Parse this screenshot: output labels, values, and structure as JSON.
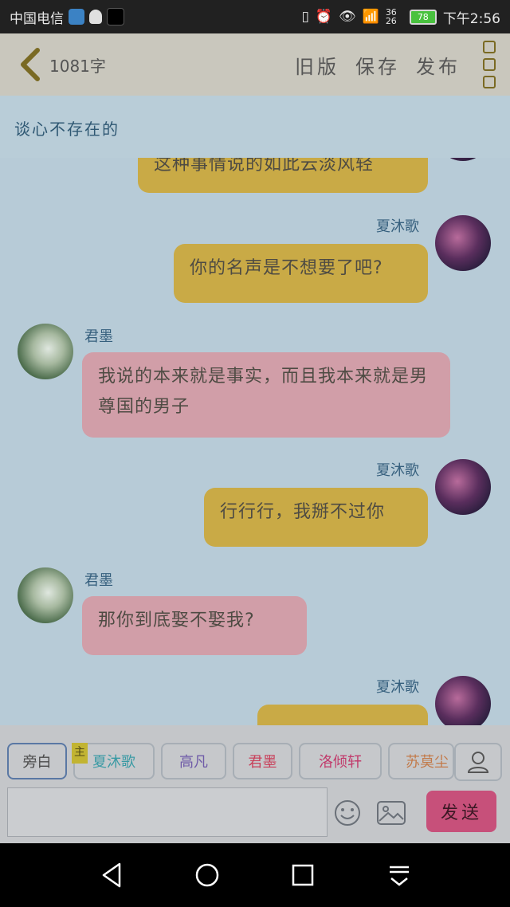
{
  "status": {
    "carrier": "中国电信",
    "network": "36 26",
    "battery": "78",
    "time": "下午2:56"
  },
  "topbar": {
    "wordcount": "1081字",
    "old_version": "旧版",
    "save": "保存",
    "publish": "发布"
  },
  "story": {
    "title": "谈心不存在的"
  },
  "messages": [
    {
      "side": "right",
      "speaker": "",
      "text": "这种事情说的如此云淡风轻",
      "color": "yellow"
    },
    {
      "side": "right",
      "speaker": "夏沐歌",
      "text": "你的名声是不想要了吧?",
      "color": "yellow"
    },
    {
      "side": "left",
      "speaker": "君墨",
      "text": "我说的本来就是事实，而且我本来就是男尊国的男子",
      "color": "pink"
    },
    {
      "side": "right",
      "speaker": "夏沐歌",
      "text": "行行行，我掰不过你",
      "color": "yellow"
    },
    {
      "side": "left",
      "speaker": "君墨",
      "text": "那你到底娶不娶我?",
      "color": "pink"
    },
    {
      "side": "right",
      "speaker": "夏沐歌",
      "text": "",
      "color": "yellow"
    }
  ],
  "roles": {
    "main_tag": "主",
    "items": [
      {
        "label": "旁白",
        "color": "#4b4b4b"
      },
      {
        "label": "夏沐歌",
        "color": "#3a9aa4"
      },
      {
        "label": "高凡",
        "color": "#6f5ba8"
      },
      {
        "label": "君墨",
        "color": "#c8405a"
      },
      {
        "label": "洛倾轩",
        "color": "#c13a6b"
      },
      {
        "label": "苏莫尘",
        "color": "#c27a4a"
      }
    ]
  },
  "composer": {
    "placeholder": "",
    "send_label": "发送"
  },
  "colors": {
    "bubble_yellow": "#c9aa46",
    "bubble_pink": "#d19ea8",
    "send_button": "#c7507a",
    "speaker_name": "#355f7d"
  }
}
